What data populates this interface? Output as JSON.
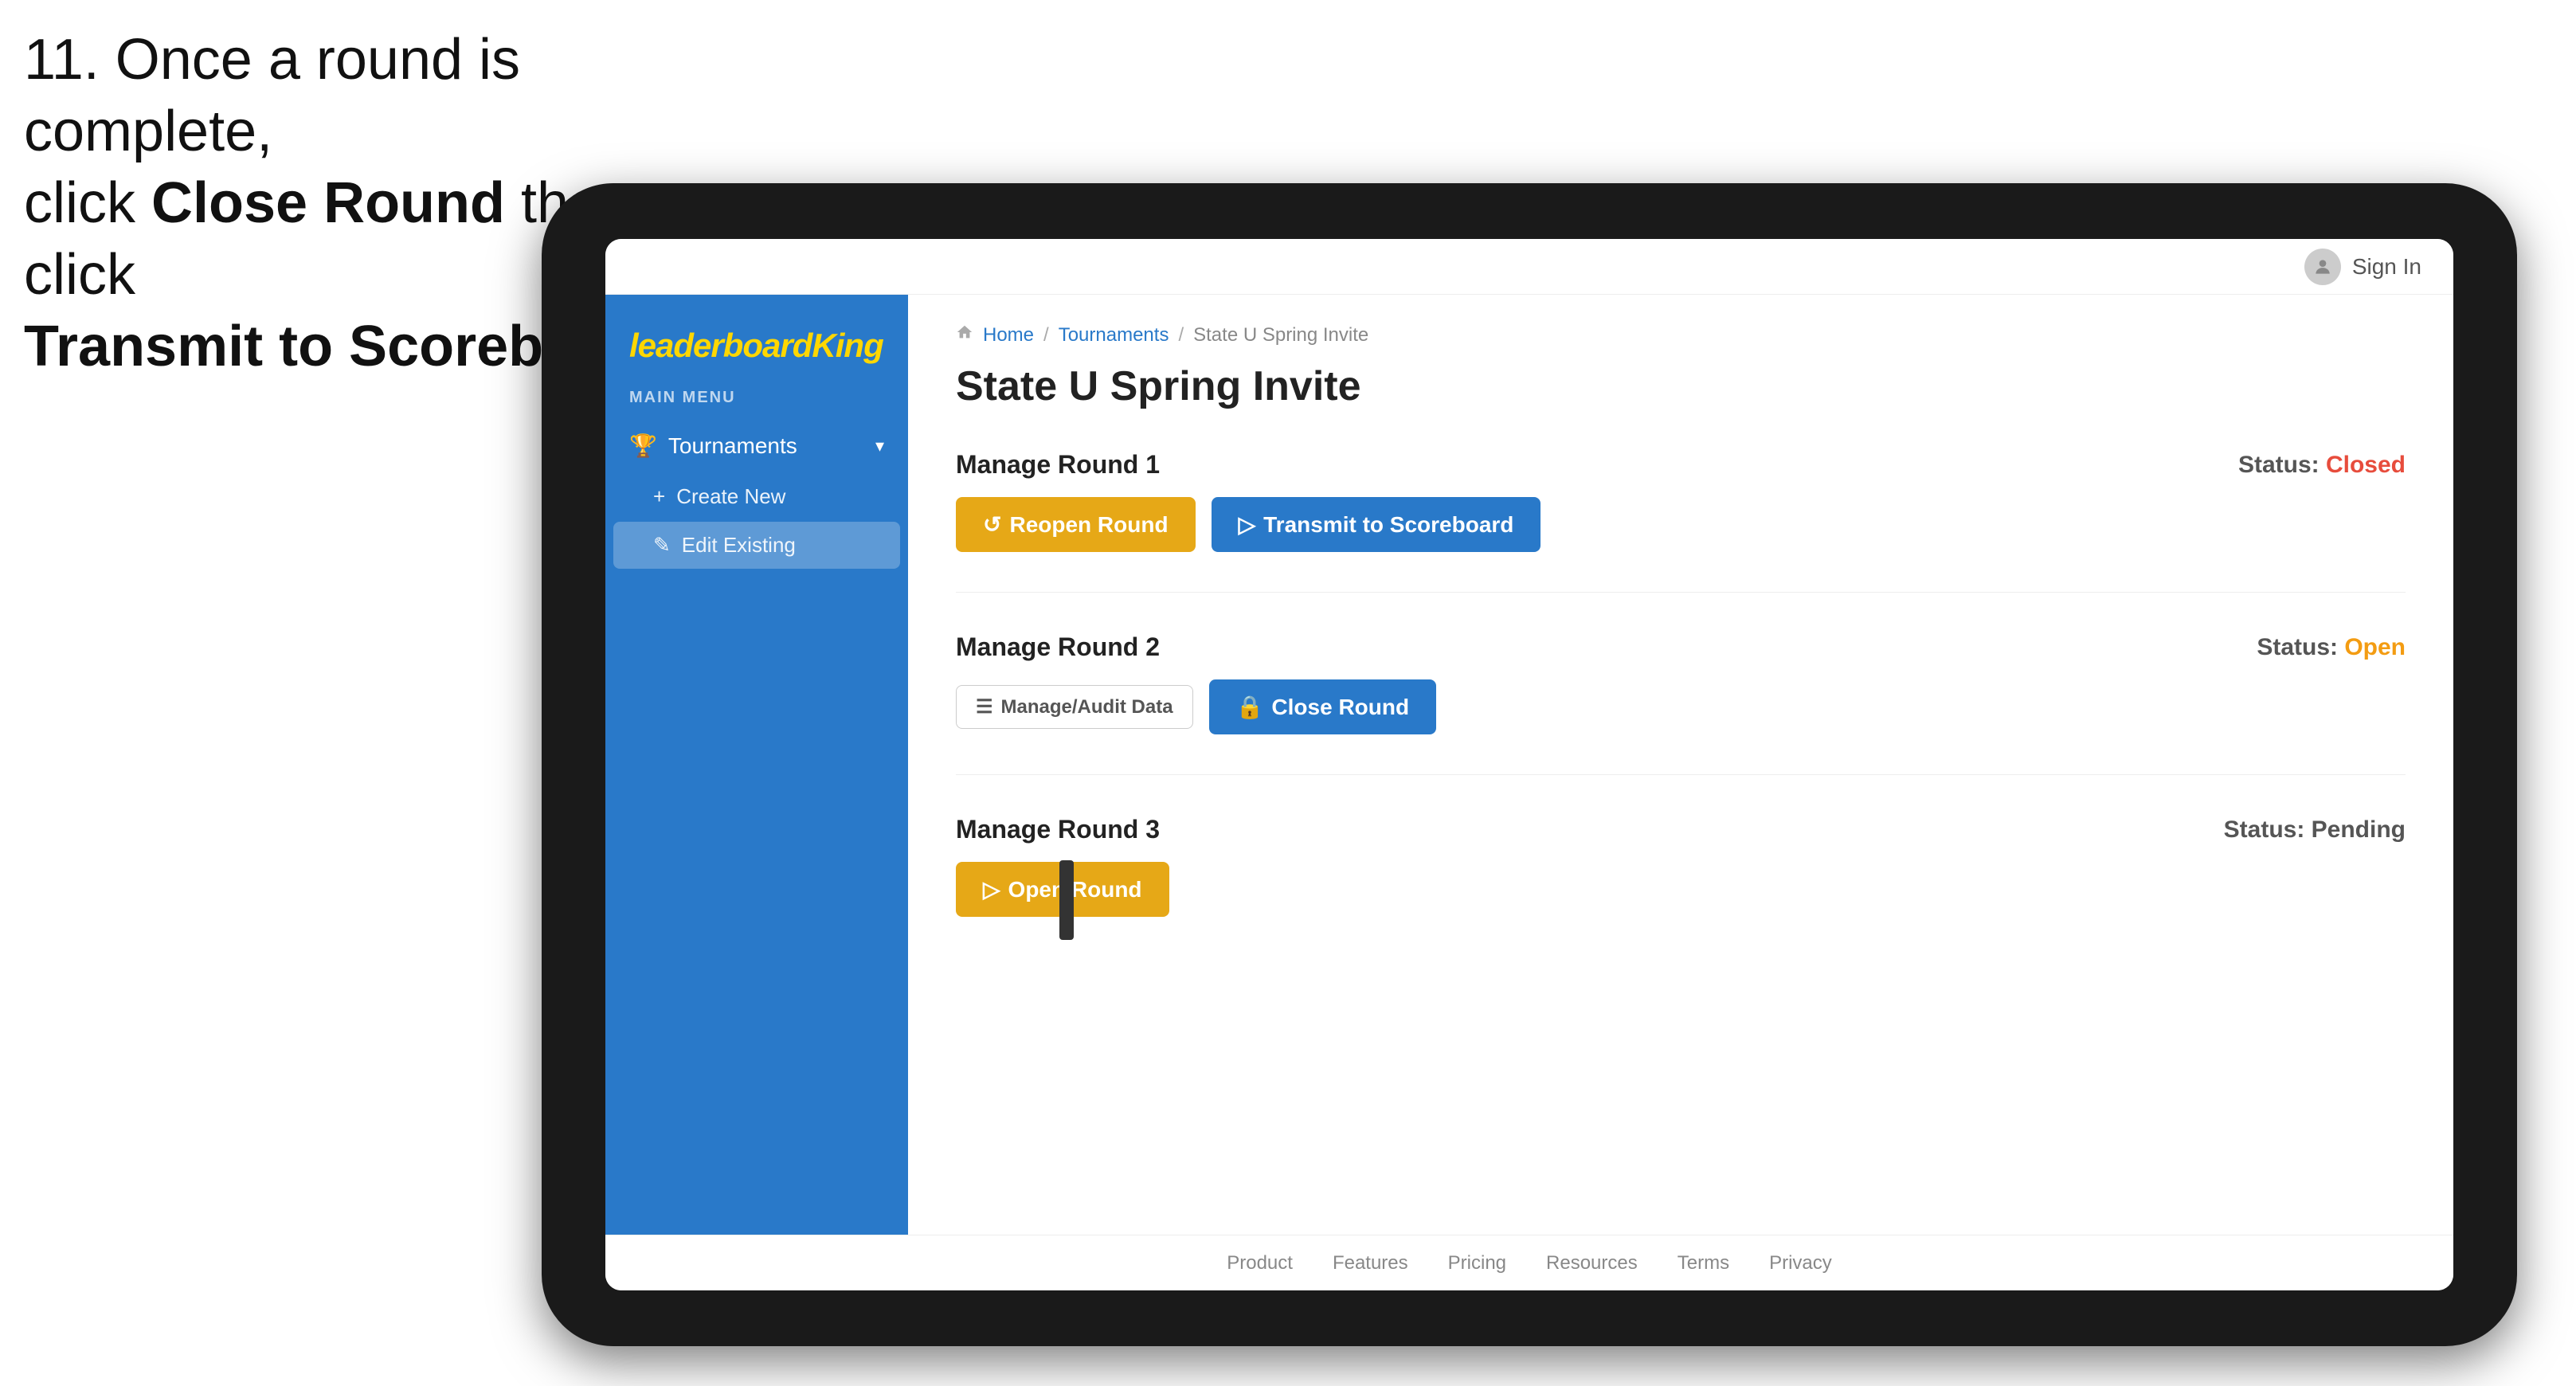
{
  "instruction": {
    "line1": "11. Once a round is complete,",
    "line2": "click ",
    "bold1": "Close Round",
    "line3": " then click",
    "bold2": "Transmit to Scoreboard."
  },
  "topbar": {
    "sign_in": "Sign In"
  },
  "sidebar": {
    "menu_label": "MAIN MENU",
    "logo": "leaderboard",
    "logo_accent": "King",
    "tournaments_label": "Tournaments",
    "create_new_label": "Create New",
    "edit_existing_label": "Edit Existing"
  },
  "breadcrumb": {
    "home": "Home",
    "sep1": "/",
    "tournaments": "Tournaments",
    "sep2": "/",
    "current": "State U Spring Invite"
  },
  "page": {
    "title": "State U Spring Invite"
  },
  "rounds": [
    {
      "id": "round1",
      "title": "Manage Round 1",
      "status_label": "Status:",
      "status_value": "Closed",
      "status_type": "closed",
      "buttons": [
        {
          "id": "reopen",
          "label": "Reopen Round",
          "style": "yellow",
          "icon": "reopen"
        },
        {
          "id": "transmit",
          "label": "Transmit to Scoreboard",
          "style": "blue",
          "icon": "transmit"
        }
      ]
    },
    {
      "id": "round2",
      "title": "Manage Round 2",
      "status_label": "Status:",
      "status_value": "Open",
      "status_type": "open",
      "buttons": [
        {
          "id": "manage_audit",
          "label": "Manage/Audit Data",
          "style": "gray",
          "icon": "audit"
        },
        {
          "id": "close",
          "label": "Close Round",
          "style": "blue",
          "icon": "close"
        }
      ]
    },
    {
      "id": "round3",
      "title": "Manage Round 3",
      "status_label": "Status:",
      "status_value": "Pending",
      "status_type": "pending",
      "buttons": [
        {
          "id": "open_round",
          "label": "Open Round",
          "style": "yellow",
          "icon": "open"
        }
      ]
    }
  ],
  "footer": {
    "links": [
      "Product",
      "Features",
      "Pricing",
      "Resources",
      "Terms",
      "Privacy"
    ]
  }
}
